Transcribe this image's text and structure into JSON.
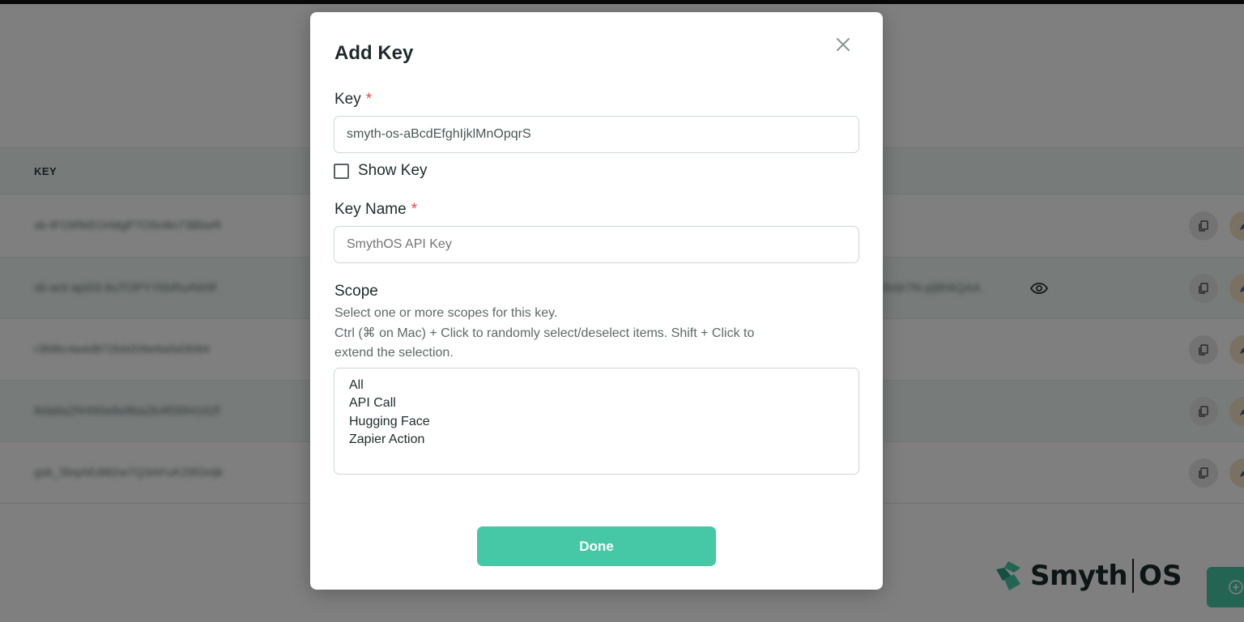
{
  "background": {
    "table": {
      "column_header": "KEY",
      "rows": [
        {
          "key_blurred": "sk-tFOiRkEOrMgP7O5n8n73BbeR",
          "key_blurred_right": ""
        },
        {
          "key_blurred": "sk-ant-api03-9uTOPYYkbRu4W9f",
          "key_blurred_right": "8xtir7N-pj8h6QAA"
        },
        {
          "key_blurred": "r3fd6c4a4d872b9209e6a5d3064",
          "key_blurred_right": ""
        },
        {
          "key_blurred": "8da8a2f4490e8e8ba2b4f0994162f",
          "key_blurred_right": ""
        },
        {
          "key_blurred": "gsk_5bqAEd6l2w7Q3AFuK29f2eijk",
          "key_blurred_right": ""
        }
      ]
    },
    "brand": {
      "name": "Smyth",
      "suffix": "OS"
    },
    "icons": {
      "eye": "eye-icon",
      "copy": "copy-icon",
      "edit": "edit-icon",
      "fab": "plus-circle-icon"
    }
  },
  "modal": {
    "title": "Add Key",
    "close_icon": "close-icon",
    "key_field": {
      "label": "Key",
      "required_mark": "*",
      "value": "smyth-os-aBcdEfghIjklMnOpqrS"
    },
    "show_key": {
      "label": "Show Key",
      "checked": false
    },
    "name_field": {
      "label": "Key Name",
      "required_mark": "*",
      "placeholder": "SmythOS API Key"
    },
    "scope": {
      "label": "Scope",
      "help_line1": "Select one or more scopes for this key.",
      "help_line2": "Ctrl (⌘ on Mac) + Click to randomly select/deselect items. Shift + Click to",
      "help_line3": "extend the selection.",
      "options": [
        "All",
        "API Call",
        "Hugging Face",
        "Zapier Action"
      ]
    },
    "done_label": "Done"
  },
  "colors": {
    "accent": "#46c8a7",
    "required": "#e5484d",
    "overlay": "rgba(0,0,0,0.5)"
  }
}
